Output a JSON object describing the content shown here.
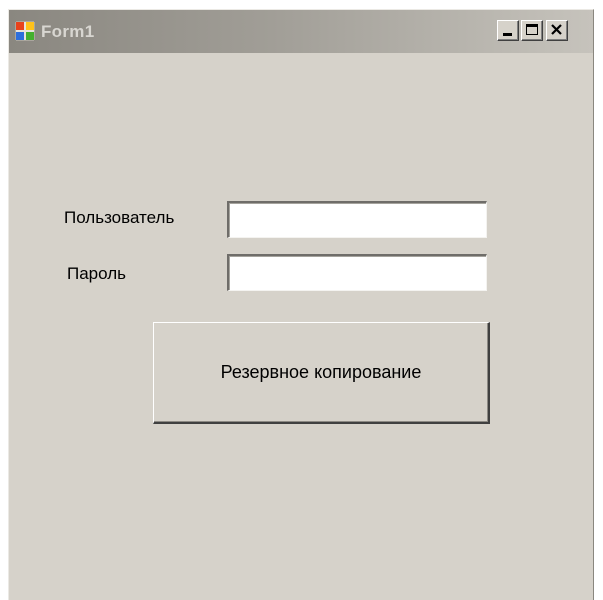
{
  "window": {
    "title": "Form1",
    "icon": "windows-forms-app-icon",
    "controls": {
      "minimize": "minimize-icon",
      "maximize": "maximize-icon",
      "close": "close-icon"
    }
  },
  "form": {
    "user_label": "Пользователь",
    "user_value": "",
    "password_label": "Пароль",
    "password_value": "",
    "backup_button_label": "Резервное копирование"
  },
  "colors": {
    "window_background": "#d6d2ca",
    "titlebar_inactive_start": "#8a8780",
    "titlebar_inactive_end": "#c6c3bc",
    "title_text": "#d8d6d1"
  }
}
